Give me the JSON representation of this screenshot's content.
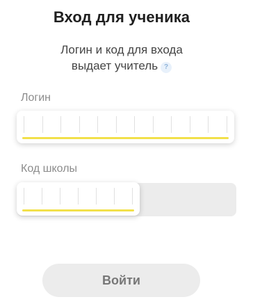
{
  "header": {
    "title": "Вход для ученика",
    "subtitle_line1": "Логин и код для входа",
    "subtitle_line2": "выдает учитель",
    "help_icon": "question-mark-icon",
    "help_glyph": "?"
  },
  "form": {
    "login": {
      "label": "Логин",
      "cells": 11,
      "value": ""
    },
    "school_code": {
      "label": "Код школы",
      "cells": 6,
      "value": ""
    },
    "submit_label": "Войти"
  },
  "colors": {
    "accent_underline": "#f2e04a",
    "disabled_button_bg": "#ececec",
    "label_gray": "#8c8c8c"
  }
}
